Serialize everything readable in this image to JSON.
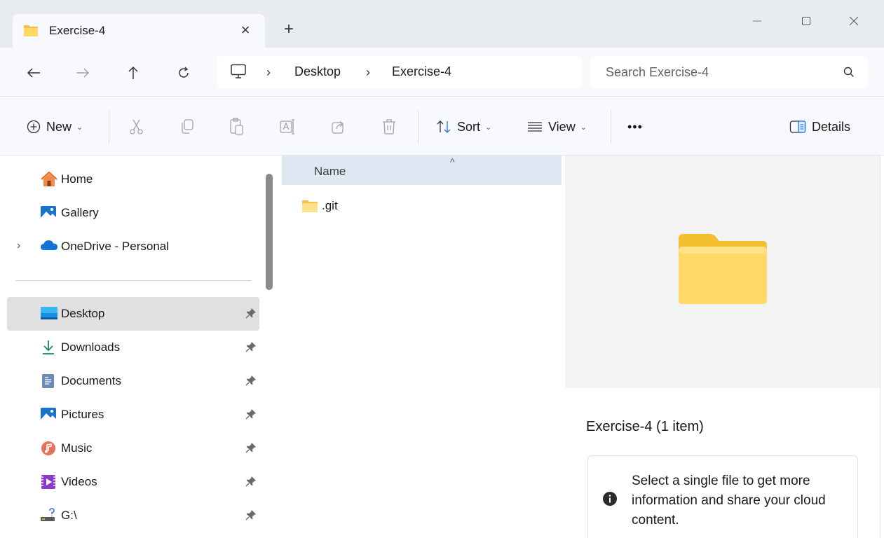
{
  "window": {
    "tab_title": "Exercise-4",
    "new_tab_label": "+",
    "tab_close_label": "×"
  },
  "navigation": {
    "path": [
      "Desktop",
      "Exercise-4"
    ],
    "search_placeholder": "Search Exercise-4"
  },
  "commands": {
    "new": "New",
    "sort": "Sort",
    "view": "View",
    "more": "•••",
    "details": "Details",
    "disabled_icons": [
      "cut-icon",
      "copy-icon",
      "paste-icon",
      "rename-icon",
      "share-icon",
      "delete-icon"
    ]
  },
  "sidebar": {
    "top_items": [
      {
        "label": "Home",
        "icon": "home-icon"
      },
      {
        "label": "Gallery",
        "icon": "gallery-icon"
      },
      {
        "label": "OneDrive - Personal",
        "icon": "onedrive-icon",
        "expandable": true
      }
    ],
    "pinned_items": [
      {
        "label": "Desktop",
        "icon": "desktop-icon",
        "selected": true
      },
      {
        "label": "Downloads",
        "icon": "downloads-icon"
      },
      {
        "label": "Documents",
        "icon": "documents-icon"
      },
      {
        "label": "Pictures",
        "icon": "pictures-icon"
      },
      {
        "label": "Music",
        "icon": "music-icon"
      },
      {
        "label": "Videos",
        "icon": "videos-icon"
      },
      {
        "label": "G:\\",
        "icon": "drive-icon"
      }
    ]
  },
  "file_list": {
    "column_name": "Name",
    "sort_indicator": "^",
    "items": [
      {
        "name": ".git",
        "type": "folder"
      }
    ]
  },
  "details_pane": {
    "title": "Exercise-4 (1 item)",
    "info_text": "Select a single file to get more information and share your cloud content."
  },
  "colors": {
    "selected_nav": "#e0e0e0",
    "column_header": "#dde8f3",
    "folder_yellow": "#f8c932",
    "preview_bg": "#f3f3f3"
  }
}
